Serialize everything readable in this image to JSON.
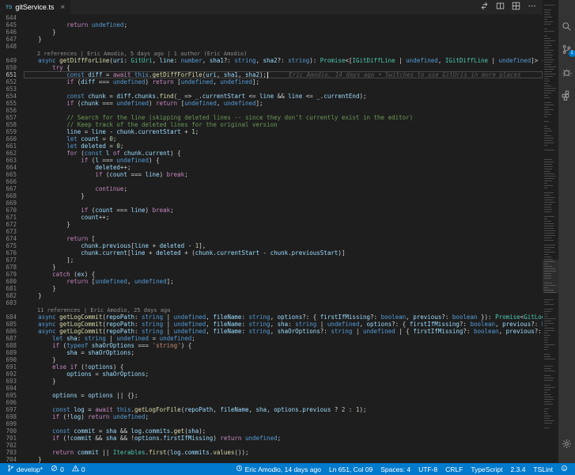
{
  "colors": {
    "accent": "#007acc",
    "status_bar_bg": "#007acc",
    "editor_bg": "#1e1e1e",
    "tab_bar_bg": "#252526",
    "activity_bar_bg": "#333333",
    "badge_bg": "#007acc",
    "file_icon_color": "#519aba"
  },
  "tab": {
    "title": "gitService.ts",
    "icon_label": "TS",
    "close_glyph": "×"
  },
  "editor_actions": [
    {
      "name": "open-changes"
    },
    {
      "name": "split-editor"
    },
    {
      "name": "toggle-editor-layout"
    },
    {
      "name": "more-actions"
    }
  ],
  "activity_bar": {
    "items": [
      {
        "name": "search"
      },
      {
        "name": "source-control",
        "badge": "1"
      },
      {
        "name": "debug"
      },
      {
        "name": "extensions"
      }
    ],
    "bottom": [
      {
        "name": "settings"
      }
    ]
  },
  "editor": {
    "current_line": 651,
    "rows": [
      {
        "n": "644",
        "t": ""
      },
      {
        "n": "645",
        "t": "            return undefined;"
      },
      {
        "n": "646",
        "t": "        }"
      },
      {
        "n": "647",
        "t": "    }"
      },
      {
        "n": "648",
        "t": ""
      },
      {
        "cl": true,
        "t": "2 references | Eric Amodio, 5 days ago | 1 author (Eric Amodio)"
      },
      {
        "n": "649",
        "t": "    async getDiffForLine(uri: GitUri, line: number, sha1?: string, sha2?: string): Promise<[IGitDiffLine | undefined, IGitDiffLine | undefined]> {"
      },
      {
        "n": "650",
        "t": "        try {"
      },
      {
        "n": "651",
        "t": "            const diff = await this.getDiffForFile(uri, sha1, sha2);",
        "cur": true,
        "blame": "Eric Amodio, 14 days ago • Switches to use GitUris in more places"
      },
      {
        "n": "652",
        "t": "            if (diff === undefined) return [undefined, undefined];"
      },
      {
        "n": "653",
        "t": ""
      },
      {
        "n": "654",
        "t": "            const chunk = diff.chunks.find(_ => _.currentStart <= line && line <= _.currentEnd);"
      },
      {
        "n": "655",
        "t": "            if (chunk === undefined) return [undefined, undefined];"
      },
      {
        "n": "656",
        "t": ""
      },
      {
        "n": "657",
        "t": "            // Search for the line (skipping deleted lines -- since they don't currently exist in the editor)"
      },
      {
        "n": "658",
        "t": "            // Keep track of the deleted lines for the original version"
      },
      {
        "n": "659",
        "t": "            line = line - chunk.currentStart + 1;"
      },
      {
        "n": "660",
        "t": "            let count = 0;"
      },
      {
        "n": "661",
        "t": "            let deleted = 0;"
      },
      {
        "n": "662",
        "t": "            for (const l of chunk.current) {"
      },
      {
        "n": "663",
        "t": "                if (l === undefined) {"
      },
      {
        "n": "664",
        "t": "                    deleted++;"
      },
      {
        "n": "665",
        "t": "                    if (count === line) break;"
      },
      {
        "n": "666",
        "t": ""
      },
      {
        "n": "667",
        "t": "                    continue;"
      },
      {
        "n": "668",
        "t": "                }"
      },
      {
        "n": "669",
        "t": ""
      },
      {
        "n": "670",
        "t": "                if (count === line) break;"
      },
      {
        "n": "671",
        "t": "                count++;"
      },
      {
        "n": "672",
        "t": "            }"
      },
      {
        "n": "673",
        "t": ""
      },
      {
        "n": "674",
        "t": "            return ["
      },
      {
        "n": "675",
        "t": "                chunk.previous[line + deleted - 1],"
      },
      {
        "n": "676",
        "t": "                chunk.current[line + deleted + (chunk.currentStart - chunk.previousStart)]"
      },
      {
        "n": "677",
        "t": "            ];"
      },
      {
        "n": "678",
        "t": "        }"
      },
      {
        "n": "679",
        "t": "        catch (ex) {"
      },
      {
        "n": "680",
        "t": "            return [undefined, undefined];"
      },
      {
        "n": "681",
        "t": "        }"
      },
      {
        "n": "682",
        "t": "    }"
      },
      {
        "n": "683",
        "t": ""
      },
      {
        "cl": true,
        "t": "11 references | Eric Amodio, 25 days ago"
      },
      {
        "n": "684",
        "t": "    async getLogCommit(repoPath: string | undefined, fileName: string, options?: { firstIfMissing?: boolean, previous?: boolean }): Promise<GitLogCommit | undefined>;"
      },
      {
        "n": "685",
        "t": "    async getLogCommit(repoPath: string | undefined, fileName: string, sha: string | undefined, options?: { firstIfMissing?: boolean, previous?: boolean }): Promise<GitLogCommit | undefined>;"
      },
      {
        "n": "686",
        "t": "    async getLogCommit(repoPath: string | undefined, fileName: string, shaOrOptions?: string | undefined | { firstIfMissing?: boolean, previous?: boolean }, options?: { firstIfMissing?: boolean, previous?: boolean }): Promise<GitLogCommit | undefined> {"
      },
      {
        "n": "687",
        "t": "        let sha: string | undefined = undefined;"
      },
      {
        "n": "688",
        "t": "        if (typeof shaOrOptions === 'string') {"
      },
      {
        "n": "689",
        "t": "            sha = shaOrOptions;"
      },
      {
        "n": "690",
        "t": "        }"
      },
      {
        "n": "691",
        "t": "        else if (!options) {"
      },
      {
        "n": "692",
        "t": "            options = shaOrOptions;"
      },
      {
        "n": "693",
        "t": "        }"
      },
      {
        "n": "694",
        "t": ""
      },
      {
        "n": "695",
        "t": "        options = options || {};"
      },
      {
        "n": "696",
        "t": ""
      },
      {
        "n": "697",
        "t": "        const log = await this.getLogForFile(repoPath, fileName, sha, options.previous ? 2 : 1);"
      },
      {
        "n": "698",
        "t": "        if (!log) return undefined;"
      },
      {
        "n": "699",
        "t": ""
      },
      {
        "n": "700",
        "t": "        const commit = sha && log.commits.get(sha);"
      },
      {
        "n": "701",
        "t": "        if (!commit && sha && !options.firstIfMissing) return undefined;"
      },
      {
        "n": "702",
        "t": ""
      },
      {
        "n": "703",
        "t": "        return commit || Iterables.first(log.commits.values());"
      },
      {
        "n": "704",
        "t": "    }"
      }
    ]
  },
  "status_bar": {
    "left": [
      {
        "name": "git-branch",
        "icon": "branch",
        "label": "develop*"
      },
      {
        "name": "errors",
        "icon": "error",
        "label": "0"
      },
      {
        "name": "warnings",
        "icon": "warning",
        "label": "0"
      }
    ],
    "right": [
      {
        "name": "gitlens-blame",
        "icon": "clock",
        "label": "Eric Amodio, 14 days ago"
      },
      {
        "name": "cursor-position",
        "label": "Ln 651, Col 09"
      },
      {
        "name": "indentation",
        "label": "Spaces: 4"
      },
      {
        "name": "encoding",
        "label": "UTF-8"
      },
      {
        "name": "eol",
        "label": "CRLF"
      },
      {
        "name": "language-mode",
        "label": "TypeScript"
      },
      {
        "name": "typescript-version",
        "label": "2.3.4"
      },
      {
        "name": "tslint",
        "label": "TSLint"
      },
      {
        "name": "feedback",
        "icon": "smiley",
        "label": ""
      }
    ]
  }
}
